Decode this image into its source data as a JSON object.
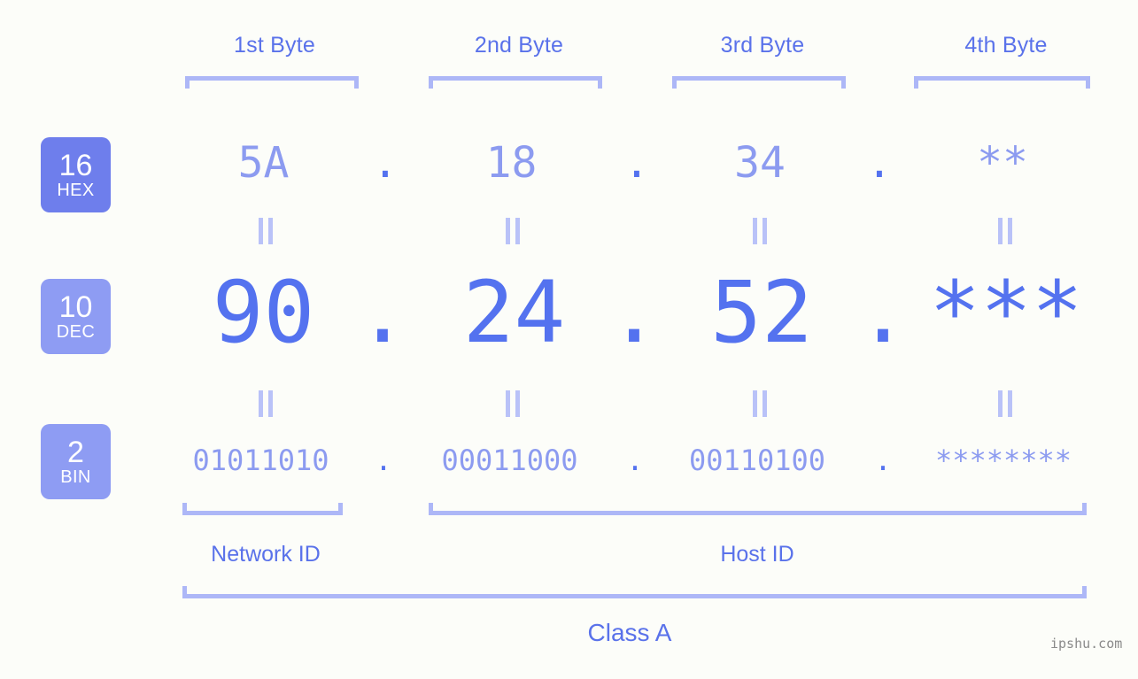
{
  "background_color": "#fcfdf9",
  "accent_strong": "#5472ef",
  "accent_light": "#8c9bf0",
  "bracket_color": "#adb7f7",
  "byte_headers": [
    {
      "label": "1st Byte"
    },
    {
      "label": "2nd Byte"
    },
    {
      "label": "3rd Byte"
    },
    {
      "label": "4th Byte"
    }
  ],
  "rows": {
    "hex": {
      "badge_num": "16",
      "badge_abbr": "HEX",
      "values": [
        "5A",
        "18",
        "34",
        "**"
      ],
      "separator": "."
    },
    "dec": {
      "badge_num": "10",
      "badge_abbr": "DEC",
      "values": [
        "90",
        "24",
        "52",
        "***"
      ],
      "separator": "."
    },
    "bin": {
      "badge_num": "2",
      "badge_abbr": "BIN",
      "values": [
        "01011010",
        "00011000",
        "00110100",
        "********"
      ],
      "separator": "."
    }
  },
  "equals_symbol": "=",
  "sections": {
    "network_id": "Network ID",
    "host_id": "Host ID",
    "class": "Class A"
  },
  "watermark": "ipshu.com"
}
